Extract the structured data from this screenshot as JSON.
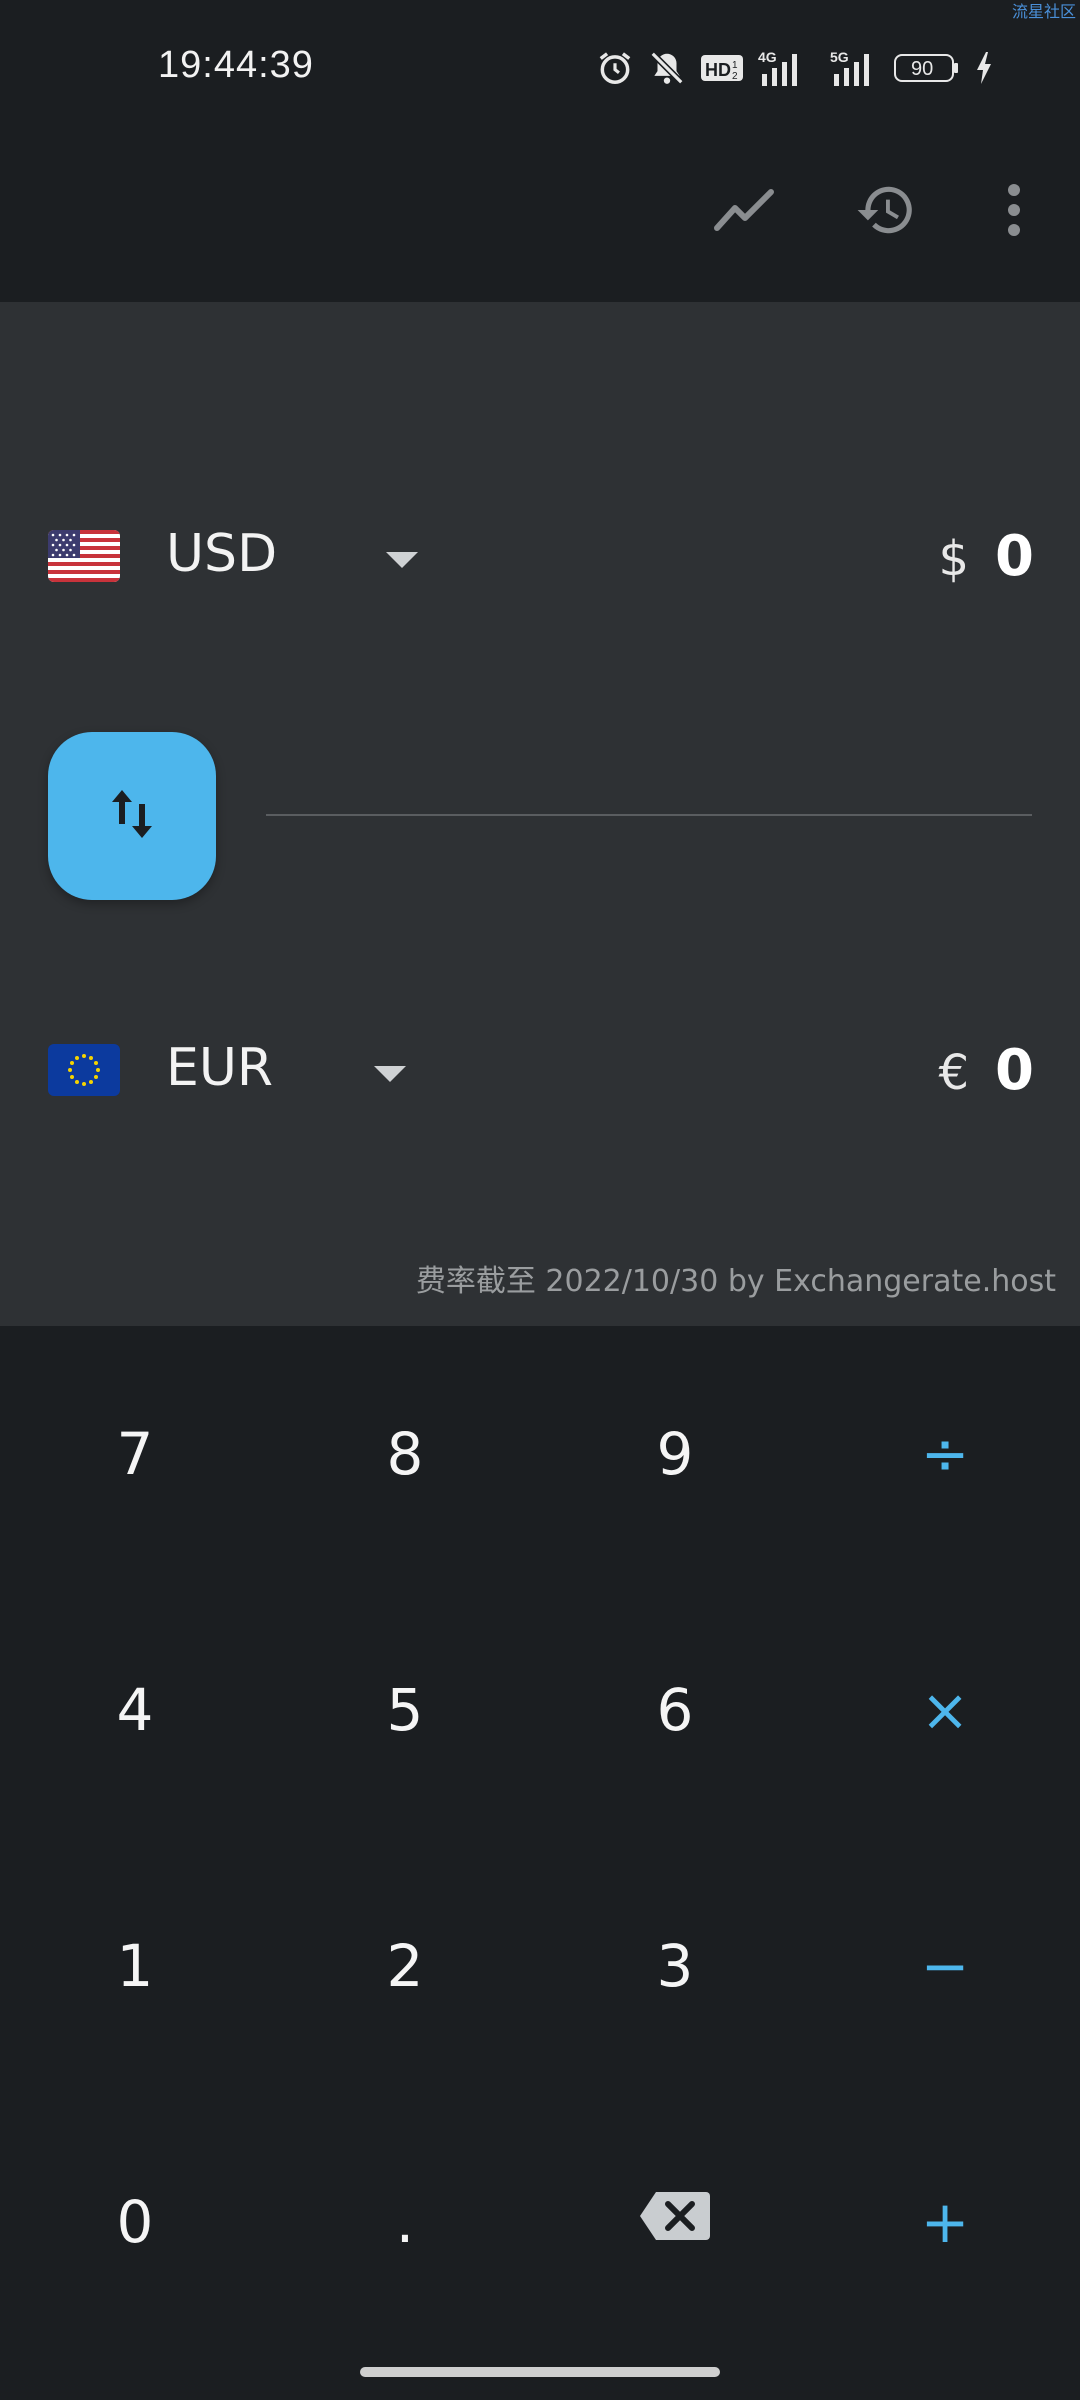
{
  "status_bar": {
    "time": "19:44:39",
    "watermark": "流星社区",
    "battery": "90",
    "icons": [
      "alarm-icon",
      "mute-bell-icon",
      "hd-icon",
      "4g-signal-icon",
      "5g-signal-icon",
      "battery-icon",
      "charging-icon"
    ]
  },
  "toolbar": {
    "icons": [
      "trend-chart-icon",
      "history-icon",
      "more-vert-icon"
    ]
  },
  "converter": {
    "from": {
      "code": "USD",
      "symbol": "$",
      "amount": "0",
      "flag": "us-flag-icon"
    },
    "to": {
      "code": "EUR",
      "symbol": "€",
      "amount": "0",
      "flag": "eu-flag-icon"
    },
    "rate_note": "费率截至 2022/10/30 by Exchangerate.host"
  },
  "keypad": {
    "row1": [
      "7",
      "8",
      "9",
      "÷"
    ],
    "row2": [
      "4",
      "5",
      "6",
      "×"
    ],
    "row3": [
      "1",
      "2",
      "3",
      "−"
    ],
    "row4": [
      "0",
      ".",
      "backspace",
      "+"
    ]
  },
  "colors": {
    "accent": "#4db6ec",
    "background": "#1b1e21",
    "panel": "#2e3134"
  }
}
